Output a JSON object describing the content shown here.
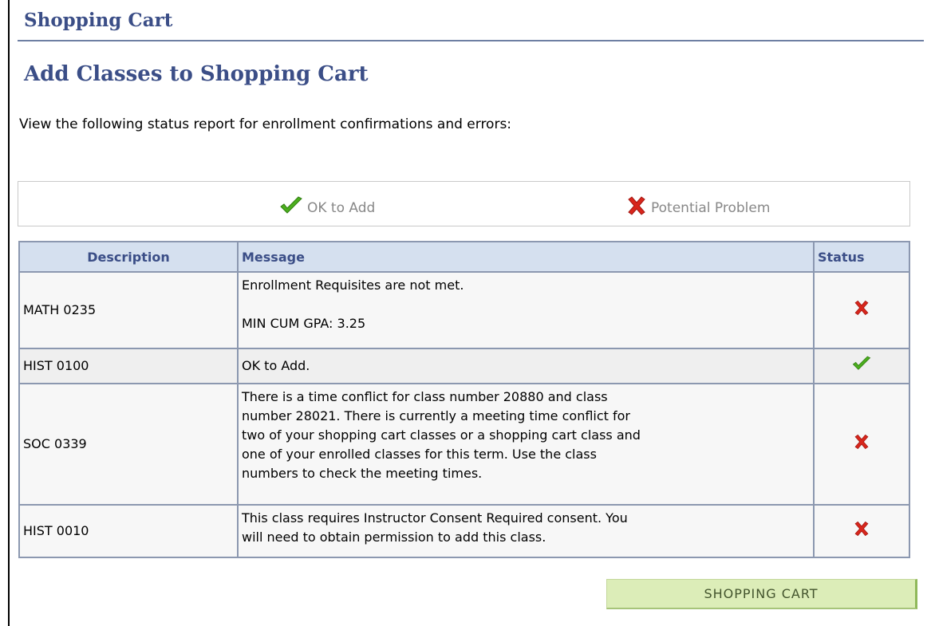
{
  "header": {
    "title": "Shopping Cart"
  },
  "main": {
    "section_title": "Add Classes to Shopping Cart",
    "intro": "View the following status report for enrollment confirmations and errors:"
  },
  "legend": {
    "ok_label": "OK to Add",
    "problem_label": "Potential Problem",
    "ok_icon": "checkmark-icon",
    "problem_icon": "x-icon"
  },
  "table": {
    "headers": {
      "description": "Description",
      "message": "Message",
      "status": "Status"
    },
    "rows": [
      {
        "description": "MATH 0235",
        "message_lines": [
          "Enrollment Requisites are not met.",
          "MIN CUM GPA: 3.25"
        ],
        "status": "problem"
      },
      {
        "description": "HIST 0100",
        "message_lines": [
          "OK to Add."
        ],
        "status": "ok"
      },
      {
        "description": "SOC 0339",
        "message_lines": [
          "There is a time conflict for class number 20880 and class",
          "number 28021. There is currently a meeting time conflict for",
          "two of your shopping cart classes or a shopping cart class and",
          "one of your enrolled classes for this term. Use the class",
          "numbers to check the meeting times."
        ],
        "status": "problem"
      },
      {
        "description": "HIST 0010",
        "message_lines": [
          "This class requires Instructor Consent Required consent. You",
          "will need to obtain permission to add this class."
        ],
        "status": "problem"
      }
    ]
  },
  "actions": {
    "shopping_cart_label": "SHOPPING CART"
  },
  "colors": {
    "title": "#3b4e87",
    "header_bg": "#d5e0ef",
    "ok_green": "#4caf1e",
    "problem_red": "#d8261c",
    "button_bg": "#dcedb8"
  }
}
